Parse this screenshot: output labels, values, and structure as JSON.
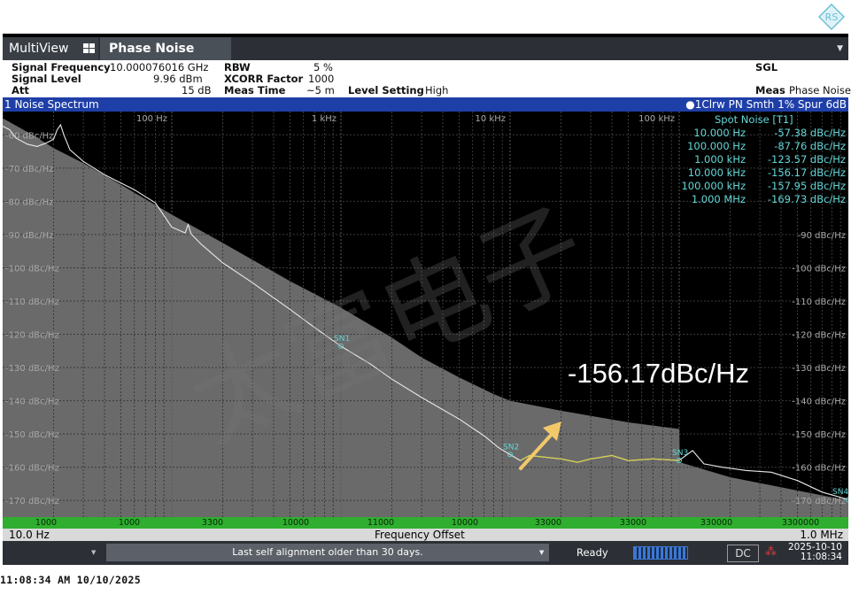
{
  "window": {
    "tab_multiview": "MultiView",
    "tab_phase_noise": "Phase Noise"
  },
  "info": {
    "signal_frequency_label": "Signal Frequency",
    "signal_frequency_value": "10.000076016 GHz",
    "signal_level_label": "Signal Level",
    "signal_level_value": "9.96 dBm",
    "att_label": "Att",
    "att_value": "15 dB",
    "rbw_label": "RBW",
    "rbw_value": "5 %",
    "xcorr_label": "XCORR Factor",
    "xcorr_value": "1000",
    "meas_time_label": "Meas Time",
    "meas_time_value": "~5 m",
    "level_setting_label": "Level Setting",
    "level_setting_value": "High",
    "sgl": "SGL",
    "meas_label": "Meas",
    "meas_value": "Phase Noise"
  },
  "trace_header": {
    "title": "1 Noise Spectrum",
    "trace_info": "●1Clrw PN Smth 1% Spur 6dB"
  },
  "spot_noise": {
    "title": "Spot Noise [T1]",
    "rows": [
      {
        "freq": "10.000 Hz",
        "value": "-57.38 dBc/Hz"
      },
      {
        "freq": "100.000 Hz",
        "value": "-87.76 dBc/Hz"
      },
      {
        "freq": "1.000 kHz",
        "value": "-123.57 dBc/Hz"
      },
      {
        "freq": "10.000 kHz",
        "value": "-156.17 dBc/Hz"
      },
      {
        "freq": "100.000 kHz",
        "value": "-157.95 dBc/Hz"
      },
      {
        "freq": "1.000 MHz",
        "value": "-169.73 dBc/Hz"
      }
    ]
  },
  "chart_data": {
    "type": "line",
    "x_scale": "log",
    "xlim": [
      10,
      1000000
    ],
    "ylim": [
      -175,
      -53
    ],
    "grid": true,
    "x_ticks": [
      {
        "value": 100,
        "label": "100 Hz"
      },
      {
        "value": 1000,
        "label": "1 kHz"
      },
      {
        "value": 10000,
        "label": "10 kHz"
      },
      {
        "value": 100000,
        "label": "100 kHz"
      }
    ],
    "y_ticks": [
      {
        "value": -60,
        "left": "-60 dBc/Hz",
        "right": ""
      },
      {
        "value": -70,
        "left": "-70 dBc/Hz",
        "right": ""
      },
      {
        "value": -80,
        "left": "-80 dBc/Hz",
        "right": ""
      },
      {
        "value": -90,
        "left": "-90 dBc/Hz",
        "right": "-90 dBc/Hz"
      },
      {
        "value": -100,
        "left": "-100 dBc/Hz",
        "right": "-100 dBc/Hz"
      },
      {
        "value": -110,
        "left": "-110 dBc/Hz",
        "right": "-110 dBc/Hz"
      },
      {
        "value": -120,
        "left": "-120 dBc/Hz",
        "right": "-120 dBc/Hz"
      },
      {
        "value": -130,
        "left": "-130 dBc/Hz",
        "right": "-130 dBc/Hz"
      },
      {
        "value": -140,
        "left": "-140 dBc/Hz",
        "right": "-140 dBc/Hz"
      },
      {
        "value": -150,
        "left": "-150 dBc/Hz",
        "right": "-150 dBc/Hz"
      },
      {
        "value": -160,
        "left": "-160 dBc/Hz",
        "right": "-160 dBc/Hz"
      },
      {
        "value": -170,
        "left": "-170 dBc/Hz",
        "right": "-170 dBc/Hz"
      }
    ],
    "series": [
      {
        "points": [
          [
            10,
            -57.4
          ],
          [
            11,
            -58.5
          ],
          [
            12,
            -61
          ],
          [
            14,
            -62.8
          ],
          [
            16,
            -63.5
          ],
          [
            18,
            -62.5
          ],
          [
            20,
            -61.3
          ],
          [
            21,
            -58.5
          ],
          [
            22,
            -57
          ],
          [
            23,
            -60
          ],
          [
            25,
            -64.5
          ],
          [
            30,
            -68
          ],
          [
            40,
            -72
          ],
          [
            60,
            -76.5
          ],
          [
            80,
            -80.5
          ],
          [
            100,
            -87.8
          ],
          [
            120,
            -89.5
          ],
          [
            125,
            -87
          ],
          [
            130,
            -89.8
          ],
          [
            150,
            -93
          ],
          [
            200,
            -98.5
          ],
          [
            300,
            -104.5
          ],
          [
            500,
            -112.5
          ],
          [
            700,
            -118
          ],
          [
            1000,
            -123.6
          ],
          [
            1500,
            -129
          ],
          [
            2000,
            -133.5
          ],
          [
            3000,
            -139
          ],
          [
            5000,
            -145.5
          ],
          [
            7000,
            -150.5
          ],
          [
            8500,
            -154
          ],
          [
            10000,
            -156.2
          ],
          [
            11500,
            -158
          ],
          [
            13000,
            -156.5
          ],
          [
            20000,
            -157.5
          ],
          [
            25000,
            -158.5
          ],
          [
            30000,
            -157.5
          ],
          [
            40000,
            -156.5
          ],
          [
            50000,
            -158
          ],
          [
            70000,
            -157.5
          ],
          [
            100000,
            -157.95
          ],
          [
            120000,
            -155
          ],
          [
            140000,
            -159
          ],
          [
            180000,
            -160
          ],
          [
            250000,
            -161
          ],
          [
            350000,
            -161.5
          ],
          [
            500000,
            -164
          ],
          [
            700000,
            -167.5
          ],
          [
            1000000,
            -169.73
          ]
        ]
      },
      {
        "name": "",
        "points": [
          [
            10,
            -55
          ],
          [
            15,
            -60
          ],
          [
            20,
            -64
          ],
          [
            30,
            -68.5
          ],
          [
            50,
            -75
          ],
          [
            100,
            -84
          ],
          [
            200,
            -92.5
          ],
          [
            500,
            -104
          ],
          [
            1000,
            -112
          ],
          [
            2000,
            -121
          ],
          [
            3000,
            -127
          ],
          [
            5000,
            -133
          ],
          [
            8000,
            -138
          ],
          [
            10000,
            -140
          ],
          [
            20000,
            -143
          ],
          [
            50000,
            -146.5
          ],
          [
            100000,
            -148.5
          ],
          [
            101000,
            -158.5
          ],
          [
            200000,
            -163
          ],
          [
            500000,
            -167
          ],
          [
            1000000,
            -170
          ]
        ]
      }
    ],
    "spot_markers": [
      {
        "label": "SN1",
        "x": 1000,
        "y": -123.57
      },
      {
        "label": "SN2",
        "x": 10000,
        "y": -156.17
      },
      {
        "label": "SN3",
        "x": 100000,
        "y": -157.95
      },
      {
        "label": "SN4",
        "x": 1000000,
        "y": -169.73
      }
    ]
  },
  "annotation": {
    "text": "-156.17dBc/Hz"
  },
  "watermark": {
    "text": "太富电子"
  },
  "segments": [
    "1000",
    "1000",
    "3300",
    "10000",
    "11000",
    "10000",
    "33000",
    "33000",
    "330000",
    "3300000"
  ],
  "axis": {
    "start": "10.0 Hz",
    "title": "Frequency Offset",
    "stop": "1.0 MHz"
  },
  "status": {
    "message": "Last self alignment older than 30 days.",
    "ready": "Ready",
    "dc": "DC",
    "date": "2025-10-10",
    "time": "11:08:34"
  },
  "timestamp": "11:08:34 AM  10/10/2025",
  "colors": {
    "trace": "#e8e8e8",
    "trace_highlight": "#d8d24a",
    "limit_area": "#6a6a6a",
    "marker": "#63d6d6",
    "arrow": "#f2c96a"
  }
}
